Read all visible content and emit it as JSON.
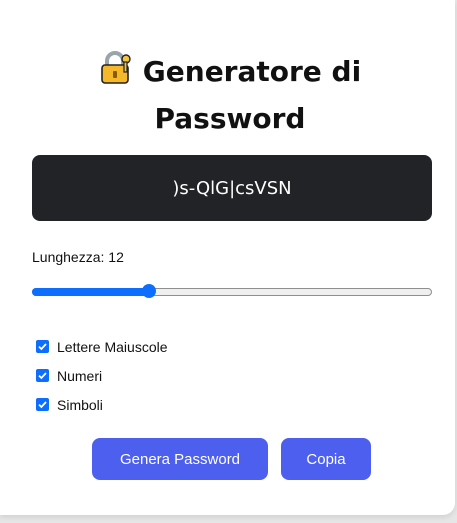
{
  "app": {
    "title_line1": "Generatore di",
    "title_line2": "Password",
    "title_icon": "lock-with-key-icon"
  },
  "password": {
    "value": ")s-QlG|csVSN"
  },
  "length": {
    "label": "Lunghezza: 12",
    "value": 12,
    "fraction": 0.295
  },
  "options": [
    {
      "label": "Lettere Maiuscole",
      "checked": true
    },
    {
      "label": "Numeri",
      "checked": true
    },
    {
      "label": "Simboli",
      "checked": true
    }
  ],
  "buttons": {
    "generate": "Genera Password",
    "copy": "Copia"
  },
  "colors": {
    "accent": "#0d6efd",
    "button": "#4c5fee",
    "password_bg": "#212327"
  }
}
